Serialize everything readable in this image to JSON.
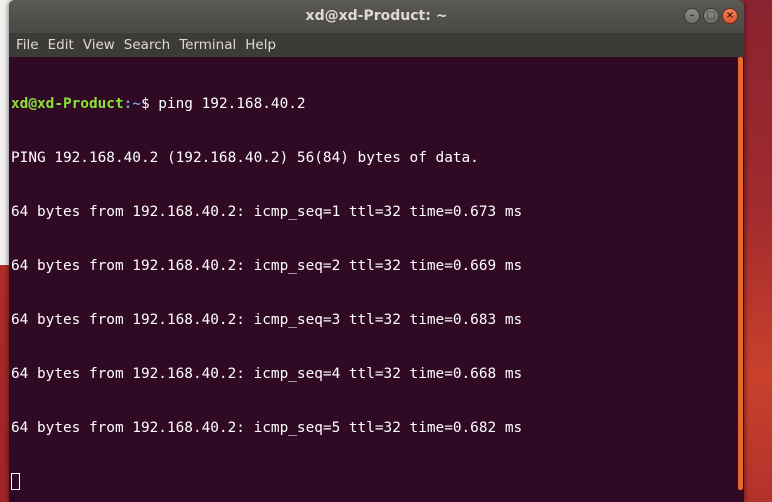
{
  "window": {
    "title": "xd@xd-Product: ~",
    "minimize_glyph": "–",
    "maximize_glyph": "□",
    "close_glyph": "×"
  },
  "menu": [
    "File",
    "Edit",
    "View",
    "Search",
    "Terminal",
    "Help"
  ],
  "terminal": {
    "prompt_user_host": "xd@xd-Product",
    "prompt_path": ":~",
    "prompt_symbol": "$ ",
    "command": "ping 192.168.40.2",
    "output": [
      "PING 192.168.40.2 (192.168.40.2) 56(84) bytes of data.",
      "64 bytes from 192.168.40.2: icmp_seq=1 ttl=32 time=0.673 ms",
      "64 bytes from 192.168.40.2: icmp_seq=2 ttl=32 time=0.669 ms",
      "64 bytes from 192.168.40.2: icmp_seq=3 ttl=32 time=0.683 ms",
      "64 bytes from 192.168.40.2: icmp_seq=4 ttl=32 time=0.668 ms",
      "64 bytes from 192.168.40.2: icmp_seq=5 ttl=32 time=0.682 ms"
    ]
  },
  "colors": {
    "terminal_bg": "#300a24",
    "prompt_user": "#8ae234",
    "prompt_path": "#729fcf",
    "scrollbar": "#e8692d"
  }
}
